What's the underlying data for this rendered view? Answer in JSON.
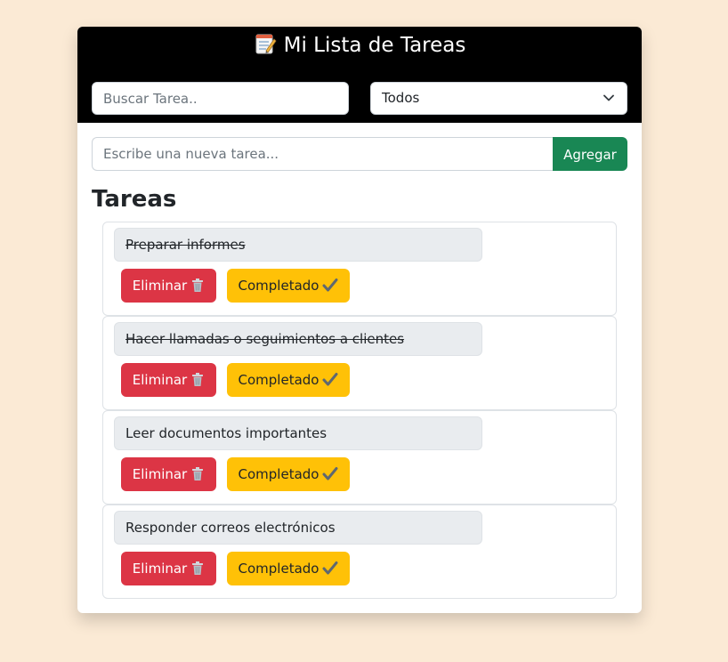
{
  "header": {
    "title": "Mi Lista de Tareas",
    "title_icon": "memo-icon",
    "background": "#000000"
  },
  "search": {
    "placeholder": "Buscar Tarea..",
    "value": ""
  },
  "filter": {
    "selected": "Todos"
  },
  "new_task": {
    "placeholder": "Escribe una nueva tarea...",
    "value": "",
    "add_label": "Agregar",
    "add_color": "#198754"
  },
  "section_title": "Tareas",
  "tasks": [
    {
      "text": "Preparar informes",
      "completed": true
    },
    {
      "text": "Hacer llamadas o seguimientos a clientes",
      "completed": true
    },
    {
      "text": "Leer documentos importantes",
      "completed": false
    },
    {
      "text": "Responder correos electrónicos",
      "completed": false
    }
  ],
  "task_actions": {
    "delete_label": "Eliminar",
    "delete_icon": "trash-icon",
    "delete_color": "#dc3545",
    "complete_label": "Completado",
    "complete_icon": "check-icon",
    "complete_color": "#ffc107"
  },
  "colors": {
    "page_background": "#fbead5"
  }
}
